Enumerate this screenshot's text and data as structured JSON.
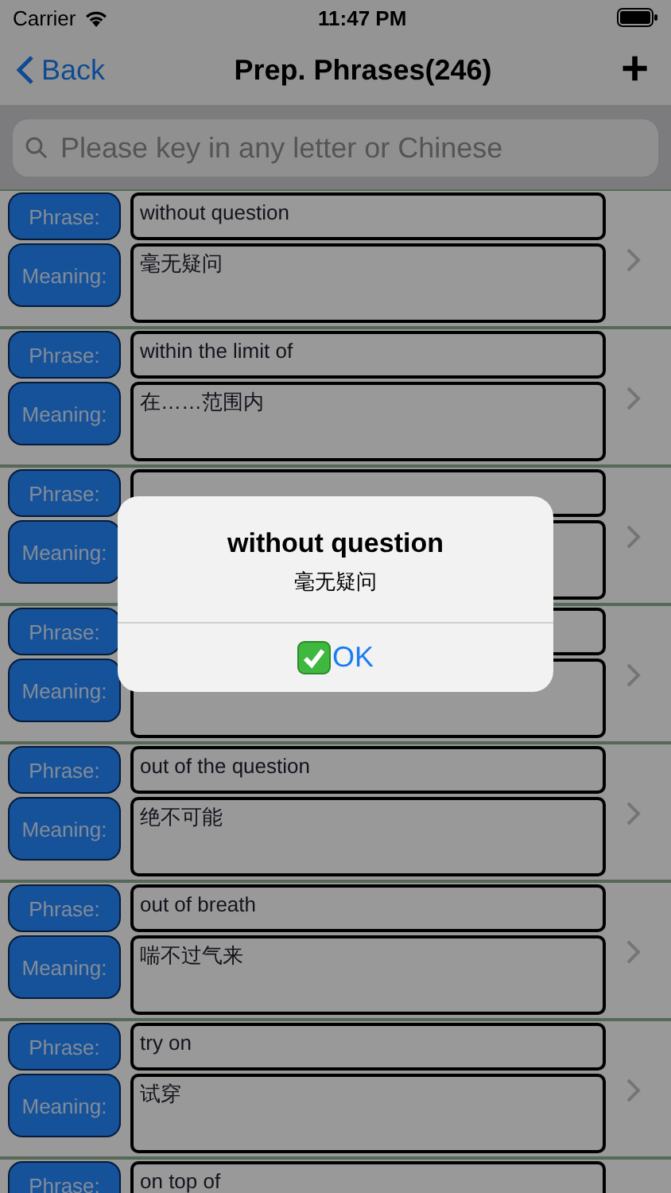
{
  "status_bar": {
    "carrier": "Carrier",
    "time": "11:47 PM"
  },
  "nav": {
    "back": "Back",
    "title": "Prep. Phrases(246)",
    "add": "+"
  },
  "search": {
    "placeholder": "Please key in any letter or Chinese"
  },
  "rows": [
    {
      "phrase_label": "Phrase:",
      "meaning_label": "Meaning:",
      "phrase": "without question",
      "meaning": "毫无疑问"
    },
    {
      "phrase_label": "Phrase:",
      "meaning_label": "Meaning:",
      "phrase": "within the limit of",
      "meaning": "在……范围内"
    },
    {
      "phrase_label": "Phrase:",
      "meaning_label": "Meaning:"
    },
    {
      "phrase_label": "Phrase:",
      "meaning_label": "Meaning:"
    },
    {
      "phrase_label": "Phrase:",
      "meaning_label": "Meaning:",
      "phrase": "out of the question",
      "meaning": "绝不可能"
    },
    {
      "phrase_label": "Phrase:",
      "meaning_label": "Meaning:",
      "phrase": "out of breath",
      "meaning": "喘不过气来"
    },
    {
      "phrase_label": "Phrase:",
      "meaning_label": "Meaning:",
      "phrase": "try on",
      "meaning": "试穿"
    },
    {
      "phrase_label": "Phrase:",
      "phrase": "on top of"
    }
  ],
  "alert": {
    "title": "without question",
    "message": "毫无疑问",
    "button": "OK"
  }
}
